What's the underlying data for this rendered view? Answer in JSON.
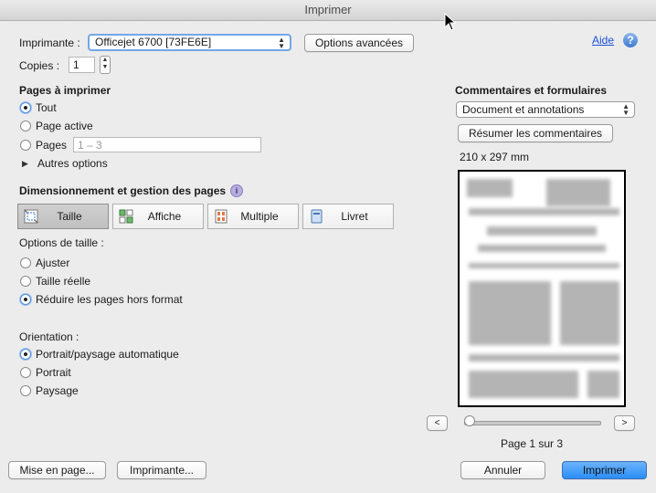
{
  "window": {
    "title": "Imprimer"
  },
  "printer": {
    "label": "Imprimante :",
    "value": "Officejet 6700 [73FE6E]",
    "advanced": "Options avancées"
  },
  "help": {
    "label": "Aide",
    "icon": "help-icon"
  },
  "copies": {
    "label": "Copies :",
    "value": "1"
  },
  "pages": {
    "heading": "Pages à imprimer",
    "options": [
      "Tout",
      "Page active",
      "Pages"
    ],
    "selected": "Tout",
    "range_placeholder": "1 – 3",
    "more": "Autres options"
  },
  "sizing": {
    "heading": "Dimensionnement et gestion des pages",
    "tabs": [
      "Taille",
      "Affiche",
      "Multiple",
      "Livret"
    ],
    "active_tab": "Taille",
    "size_options_label": "Options de taille :",
    "size_options": [
      "Ajuster",
      "Taille réelle",
      "Réduire les pages hors format"
    ],
    "size_selected": "Réduire les pages hors format"
  },
  "orientation": {
    "label": "Orientation :",
    "options": [
      "Portrait/paysage automatique",
      "Portrait",
      "Paysage"
    ],
    "selected": "Portrait/paysage automatique"
  },
  "comments": {
    "heading": "Commentaires et formulaires",
    "value": "Document et annotations",
    "summarize": "Résumer les commentaires"
  },
  "preview": {
    "dimensions": "210 x 297 mm",
    "prev": "<",
    "next": ">",
    "page_info": "Page 1 sur 3",
    "slider_value": 0
  },
  "footer": {
    "page_setup": "Mise en page...",
    "printer": "Imprimante...",
    "cancel": "Annuler",
    "print": "Imprimer"
  },
  "colors": {
    "accent": "#2a8ef7",
    "link": "#1c4fd8",
    "active_segment": "#c6c6c6"
  }
}
